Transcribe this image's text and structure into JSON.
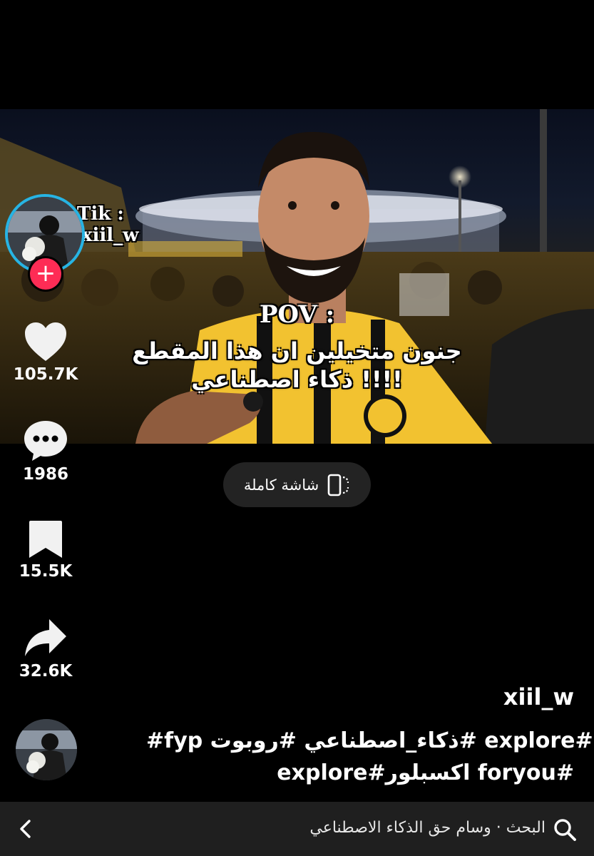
{
  "video": {
    "overlay_pov": "POV :",
    "overlay_line1": "جنون متخيلين ان هذا المقطع",
    "overlay_line2": "ذكاء اصطناعي !!!!",
    "watermark_line1": "Tik :",
    "watermark_line2": "xiil_w"
  },
  "actions": {
    "likes": "105.7K",
    "comments": "1986",
    "saves": "15.5K",
    "shares": "32.6K",
    "follow_symbol": "+"
  },
  "fullscreen": {
    "label": "شاشة كاملة"
  },
  "post": {
    "username": "xiil_w",
    "description_line1": "#fyp ذكاء_اصطناعي #روبوت# explore#",
    "description_line2": "explore#اكسبلور foryou#"
  },
  "bottom_bar": {
    "search_text": "البحث · وسام حق الذكاء الاصطناعي"
  },
  "colors": {
    "follow_button": "#fe2c55",
    "avatar_ring": "#27b4e4",
    "background": "#000000",
    "jersey": "#f2c230"
  },
  "icons": {
    "like": "heart-icon",
    "comment": "comment-bubble-icon",
    "save": "bookmark-icon",
    "share": "share-arrow-icon",
    "fullscreen": "rotate-fullscreen-icon",
    "search": "search-icon",
    "back": "chevron-left-icon"
  }
}
